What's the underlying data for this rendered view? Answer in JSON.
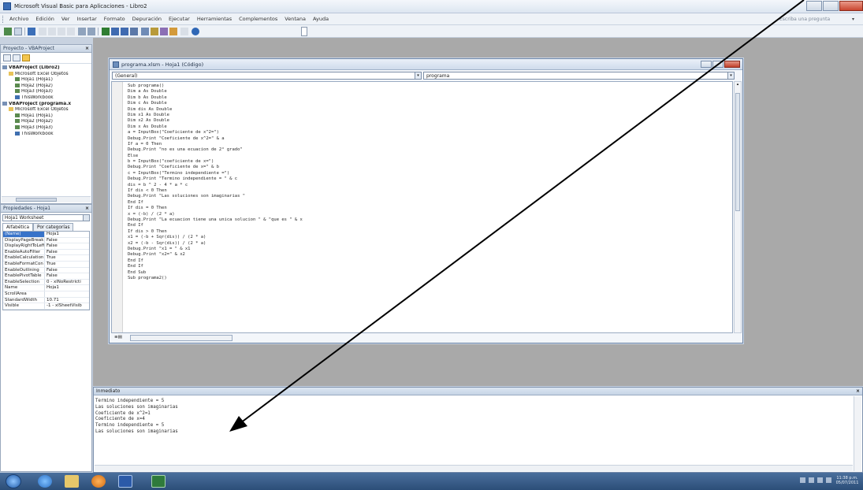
{
  "window": {
    "title": "Microsoft Visual Basic para Aplicaciones - Libro2"
  },
  "menu": {
    "items": [
      "Archivo",
      "Edición",
      "Ver",
      "Insertar",
      "Formato",
      "Depuración",
      "Ejecutar",
      "Herramientas",
      "Complementos",
      "Ventana",
      "Ayuda"
    ],
    "help_placeholder": "Escriba una pregunta"
  },
  "project": {
    "title": "Proyecto - VBAProject",
    "tree": [
      {
        "label": "VBAProject (Libro2)",
        "icon": "project-icon",
        "level": 0,
        "bold": true
      },
      {
        "label": "Microsoft Excel Objetos",
        "icon": "folder-icon",
        "level": 1,
        "bold": false
      },
      {
        "label": "Hoja1 (Hoja1)",
        "icon": "sheet-icon",
        "level": 2,
        "bold": false
      },
      {
        "label": "Hoja2 (Hoja2)",
        "icon": "sheet-icon",
        "level": 2,
        "bold": false
      },
      {
        "label": "Hoja3 (Hoja3)",
        "icon": "sheet-icon",
        "level": 2,
        "bold": false
      },
      {
        "label": "ThisWorkbook",
        "icon": "workbook-icon",
        "level": 2,
        "bold": false
      },
      {
        "label": "VBAProject (programa.x",
        "icon": "project-icon",
        "level": 0,
        "bold": true
      },
      {
        "label": "Microsoft Excel Objetos",
        "icon": "folder-icon",
        "level": 1,
        "bold": false
      },
      {
        "label": "Hoja1 (Hoja1)",
        "icon": "sheet-icon",
        "level": 2,
        "bold": false
      },
      {
        "label": "Hoja2 (Hoja2)",
        "icon": "sheet-icon",
        "level": 2,
        "bold": false
      },
      {
        "label": "Hoja3 (Hoja3)",
        "icon": "sheet-icon",
        "level": 2,
        "bold": false
      },
      {
        "label": "ThisWorkbook",
        "icon": "workbook-icon",
        "level": 2,
        "bold": false
      }
    ]
  },
  "properties": {
    "title": "Propiedades - Hoja1",
    "object_select": "Hoja1 Worksheet",
    "tabs": [
      "Alfabética",
      "Por categorías"
    ],
    "rows": [
      {
        "name": "(Name)",
        "value": "Hoja1"
      },
      {
        "name": "DisplayPageBreak",
        "value": "False"
      },
      {
        "name": "DisplayRightToLeft",
        "value": "False"
      },
      {
        "name": "EnableAutoFilter",
        "value": "False"
      },
      {
        "name": "EnableCalculation",
        "value": "True"
      },
      {
        "name": "EnableFormatCon",
        "value": "True"
      },
      {
        "name": "EnableOutlining",
        "value": "False"
      },
      {
        "name": "EnablePivotTable",
        "value": "False"
      },
      {
        "name": "EnableSelection",
        "value": "0 - xlNoRestricti"
      },
      {
        "name": "Name",
        "value": "Hoja1"
      },
      {
        "name": "ScrollArea",
        "value": ""
      },
      {
        "name": "StandardWidth",
        "value": "10.71"
      },
      {
        "name": "Visible",
        "value": "-1 - xlSheetVisib"
      }
    ]
  },
  "code_window": {
    "title": "programa.xlsm - Hoja1 (Código)",
    "object_combo": "(General)",
    "proc_combo": "programa",
    "lines": [
      "Sub programa()",
      "Dim a As Double",
      "Dim b As Double",
      "Dim c As Double",
      "Dim dis As Double",
      "Dim x1 As Double",
      "Dim x2 As Double",
      "Dim x As Double",
      "a = InputBox(\"Coeficiente de x^2=\")",
      "Debug.Print \"Coeficiente de x^2=\" & a",
      "If a = 0 Then",
      "Debug.Print \"no es una ecuacion de 2° grado\"",
      "Else",
      "b = InputBox(\"coeficiente de x=\")",
      "Debug.Print \"Coeficiente de x=\" & b",
      "c = InputBox(\"Termino independiente =\")",
      "Debug.Print \"Termino independiente = \" & c",
      "dis = b ^ 2 - 4 * a * c",
      "If dis < 0 Then",
      "Debug.Print \"Las soluciones son imaginarias \"",
      "End If",
      "If dis = 0 Then",
      "x = (-b) / (2 * a)",
      "Debug.Print \"La ecuacion tiene una unica solucion \" & \"que es \" & x",
      "End If",
      "If dis > 0 Then",
      "x1 = (-b + Sqr(dis)) / (2 * a)",
      "x2 = (-b - Sqr(dis)) / (2 * a)",
      "Debug.Print \"x1 = \" & x1",
      "Debug.Print \"x2=\" & x2",
      "End If",
      "End If",
      "End Sub",
      "Sub programa2()"
    ]
  },
  "immediate": {
    "title": "Inmediato",
    "lines": [
      "Termino independiente = 5",
      "Las soluciones son imaginarias",
      "Coeficiente de x^2=1",
      "Coeficiente de x=4",
      "Termino independiente = 5",
      "Las soluciones son imaginarias"
    ]
  },
  "taskbar": {
    "clock_time": "11:38 p.m.",
    "clock_date": "05/07/2011"
  },
  "colors": {
    "accent": "#3873c9",
    "arrow": "#000000"
  }
}
